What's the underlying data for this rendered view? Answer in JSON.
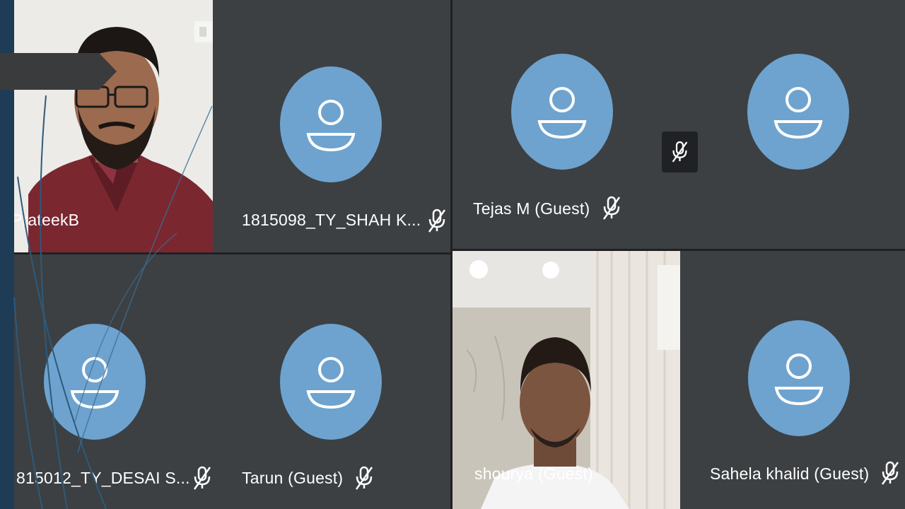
{
  "meeting": {
    "participants": [
      {
        "name": "PrateekB",
        "video": true,
        "muted": false
      },
      {
        "name": "1815098_TY_SHAH K...",
        "video": false,
        "muted": true
      },
      {
        "name": "Tejas M (Guest)",
        "video": false,
        "muted": true
      },
      {
        "name": "",
        "video": false,
        "muted": true
      },
      {
        "name": "815012_TY_DESAI S...",
        "video": false,
        "muted": true
      },
      {
        "name": "Tarun (Guest)",
        "video": false,
        "muted": true
      },
      {
        "name": "shourya (Guest)",
        "video": true,
        "muted": false
      },
      {
        "name": "Sahela khalid (Guest)",
        "video": false,
        "muted": true
      }
    ]
  },
  "colors": {
    "tile": "#3c4043",
    "avatar": "#6ea3cf",
    "background": "#202124",
    "slide_accent": "#1e3c55"
  },
  "icons": {
    "avatar": "person-icon",
    "muted": "mic-off-icon"
  }
}
